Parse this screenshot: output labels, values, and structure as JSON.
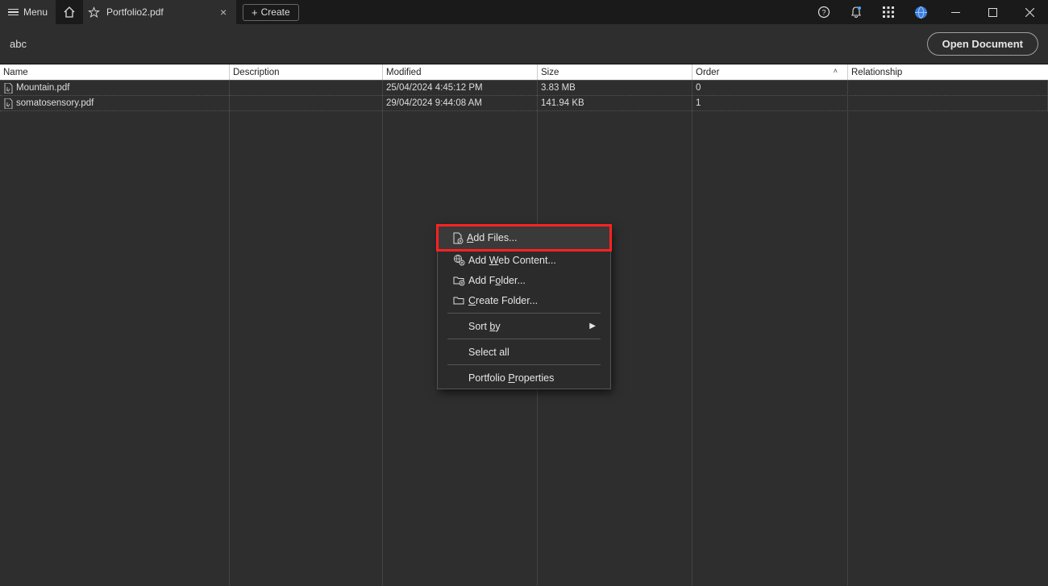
{
  "titlebar": {
    "menu_label": "Menu",
    "tab_title": "Portfolio2.pdf",
    "create_label": "Create"
  },
  "secondbar": {
    "path": "abc",
    "open_document_label": "Open Document"
  },
  "columns": {
    "name": "Name",
    "description": "Description",
    "modified": "Modified",
    "size": "Size",
    "order": "Order",
    "relationship": "Relationship"
  },
  "rows": [
    {
      "name": "Mountain.pdf",
      "description": "",
      "modified": "25/04/2024 4:45:12 PM",
      "size": "3.83 MB",
      "order": "0",
      "relationship": ""
    },
    {
      "name": "somatosensory.pdf",
      "description": "",
      "modified": "29/04/2024 9:44:08 AM",
      "size": "141.94 KB",
      "order": "1",
      "relationship": ""
    }
  ],
  "context_menu": {
    "add_files": "Add Files...",
    "add_web_content": "Add Web Content...",
    "add_folder": "Add Folder...",
    "create_folder": "Create Folder...",
    "sort_by": "Sort by",
    "select_all": "Select all",
    "portfolio_properties": "Portfolio Properties"
  }
}
